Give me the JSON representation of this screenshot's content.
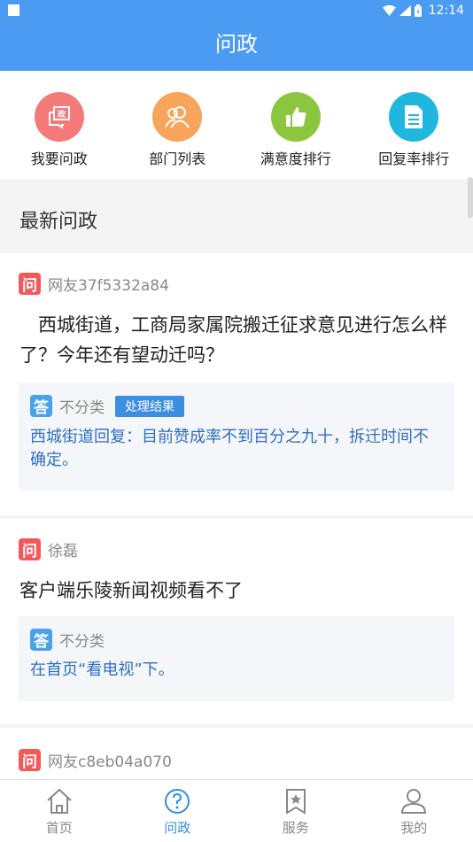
{
  "status_bar": {
    "time": "12:14"
  },
  "header": {
    "title": "问政"
  },
  "quick_actions": [
    {
      "label": "我要问政",
      "icon": "ask-icon",
      "color": "#f47a7a"
    },
    {
      "label": "部门列表",
      "icon": "people-icon",
      "color": "#f6a55a"
    },
    {
      "label": "满意度排行",
      "icon": "thumbs-up-icon",
      "color": "#8cc63f"
    },
    {
      "label": "回复率排行",
      "icon": "document-icon",
      "color": "#1fb6e0"
    }
  ],
  "section": {
    "title": "最新问政"
  },
  "tags": {
    "question": "问",
    "answer": "答"
  },
  "posts": [
    {
      "user": "网友37f5332a84",
      "question": "西城街道，工商局家属院搬迁征求意见进行怎么样了？今年还有望动迁吗？",
      "category": "不分类",
      "badge": "处理结果",
      "answer": "西城街道回复：目前赞成率不到百分之九十，拆迁时间不确定。"
    },
    {
      "user": "徐磊",
      "question": "客户端乐陵新闻视频看不了",
      "category": "不分类",
      "answer": "在首页“看电视”下。"
    },
    {
      "user": "网友c8eb04a070"
    }
  ],
  "bottom_nav": [
    {
      "label": "首页",
      "icon": "home-icon"
    },
    {
      "label": "问政",
      "icon": "question-icon",
      "active": true
    },
    {
      "label": "服务",
      "icon": "bookmark-star-icon"
    },
    {
      "label": "我的",
      "icon": "person-icon"
    }
  ],
  "colors": {
    "primary": "#4a9bf1",
    "active_tab": "#2f8ee6",
    "answer_text": "#2f6fc0",
    "question_tag": "#f05a5a",
    "answer_tag": "#4aa3ea"
  }
}
